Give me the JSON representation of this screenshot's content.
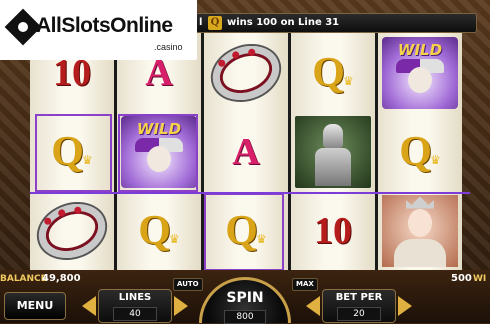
{
  "logo": {
    "brand": "AllSlotsOnline",
    "tld": ".casino"
  },
  "infobar": {
    "prefix": "l",
    "icon": "Q",
    "message": "wins 100 on Line 31"
  },
  "reels": [
    [
      "10",
      "Q",
      "ring"
    ],
    [
      "A",
      "WILD",
      "Q"
    ],
    [
      "ring",
      "A",
      "Q"
    ],
    [
      "Q",
      "knight",
      "10"
    ],
    [
      "WILD",
      "Q",
      "queen"
    ]
  ],
  "wild_label": "WILD",
  "payline_color": "#7c3cd8",
  "highlight_color": "#8a40c8",
  "bottom": {
    "balance_label": "BALANCE",
    "balance_value": "49,800",
    "win_label": "WI",
    "win_value": "500",
    "menu_label": "MENU",
    "lines_label": "LINES",
    "lines_value": "40",
    "auto_label": "AUTO",
    "spin_label": "SPIN",
    "spin_value": "800",
    "max_label": "MAX",
    "bet_label": "BET PER",
    "bet_value": "20"
  },
  "colors": {
    "accent_gold": "#e0b040",
    "frame_brown": "#3b2412"
  }
}
